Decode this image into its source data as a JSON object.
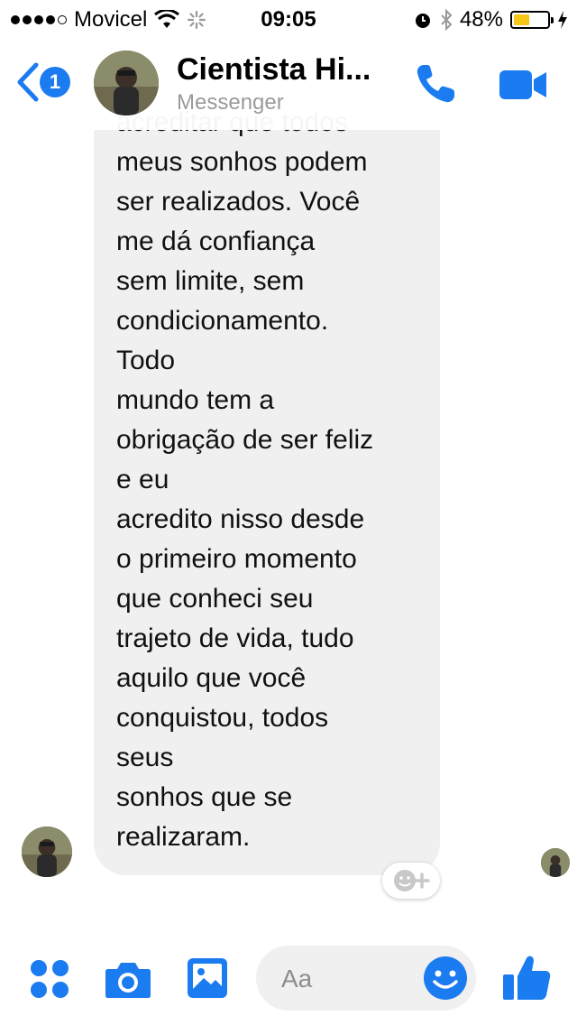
{
  "status_bar": {
    "carrier": "Movicel",
    "time": "09:05",
    "battery_percent": "48%",
    "battery_level": 0.48
  },
  "header": {
    "back_badge": "1",
    "contact_name": "Cientista Hi...",
    "subtitle": "Messenger",
    "accent_color": "#1b7bf0"
  },
  "message": {
    "text_top_clipped": "acreditar que todos",
    "text": "meus sonhos podem\nser realizados. Você\nme dá confiança\nsem limite, sem\ncondicionamento.\nTodo\nmundo tem a\nobrigação de ser feliz\ne eu\nacredito nisso desde\no primeiro momento\nque conheci seu\ntrajeto de vida, tudo\naquilo que você\nconquistou, todos\nseus\nsonhos que se\nrealizaram."
  },
  "composer": {
    "placeholder": "Aa"
  },
  "icons": {
    "menu": "grid-icon",
    "camera": "camera-icon",
    "gallery": "image-icon",
    "emoji": "smile-icon",
    "like": "thumbs-up-icon",
    "call": "phone-icon",
    "video": "video-icon",
    "back": "chevron-left-icon"
  }
}
